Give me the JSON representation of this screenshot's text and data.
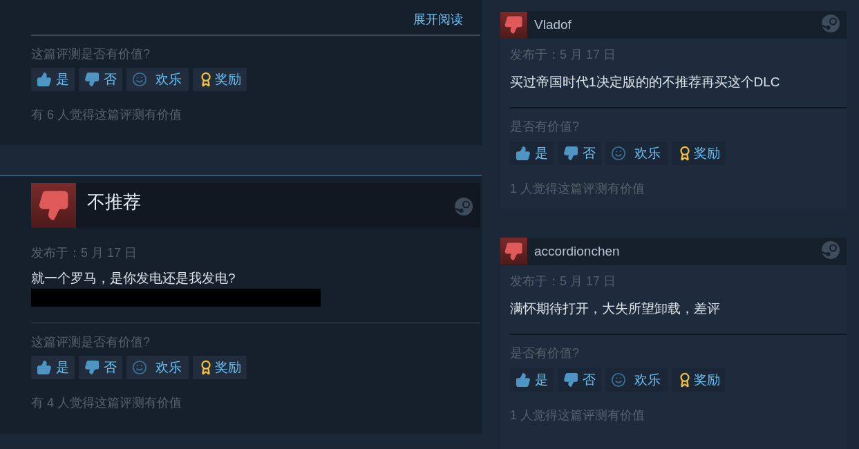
{
  "left_column": {
    "previous_review_end": {
      "expand_link": "展开阅读",
      "helpful_question": "这篇评测是否有价值?",
      "vote_buttons": [
        {
          "kind": "yes",
          "label": "是"
        },
        {
          "kind": "no",
          "label": "否"
        },
        {
          "kind": "funny",
          "label": "欢乐"
        },
        {
          "kind": "award",
          "label": "奖励"
        }
      ],
      "helpful_count": "有 6 人觉得这篇评测有价值"
    },
    "review": {
      "recommended": false,
      "title": "不推荐",
      "posted": "发布于：5 月 17 日",
      "text": "就一个罗马，是你发电还是我发电?",
      "redacted": true,
      "helpful_question": "这篇评测是否有价值?",
      "vote_buttons": [
        {
          "kind": "yes",
          "label": "是"
        },
        {
          "kind": "no",
          "label": "否"
        },
        {
          "kind": "funny",
          "label": "欢乐"
        },
        {
          "kind": "award",
          "label": "奖励"
        }
      ],
      "helpful_count": "有 4 人觉得这篇评测有价值"
    }
  },
  "right_column": {
    "reviews": [
      {
        "recommended": false,
        "author": "Vladof",
        "posted": "发布于：5 月 17 日",
        "text": "买过帝国时代1决定版的的不推荐再买这个DLC",
        "helpful_question": "是否有价值?",
        "vote_buttons": [
          {
            "kind": "yes",
            "label": "是"
          },
          {
            "kind": "no",
            "label": "否"
          },
          {
            "kind": "funny",
            "label": "欢乐"
          },
          {
            "kind": "award",
            "label": "奖励"
          }
        ],
        "helpful_count": "1 人觉得这篇评测有价值"
      },
      {
        "recommended": false,
        "author": "accordionchen",
        "posted": "发布于：5 月 17 日",
        "text": "满怀期待打开，大失所望卸载，差评",
        "helpful_question": "是否有价值?",
        "vote_buttons": [
          {
            "kind": "yes",
            "label": "是"
          },
          {
            "kind": "no",
            "label": "否"
          },
          {
            "kind": "funny",
            "label": "欢乐"
          },
          {
            "kind": "award",
            "label": "奖励"
          }
        ],
        "helpful_count": "1 人觉得这篇评测有价值"
      }
    ]
  }
}
